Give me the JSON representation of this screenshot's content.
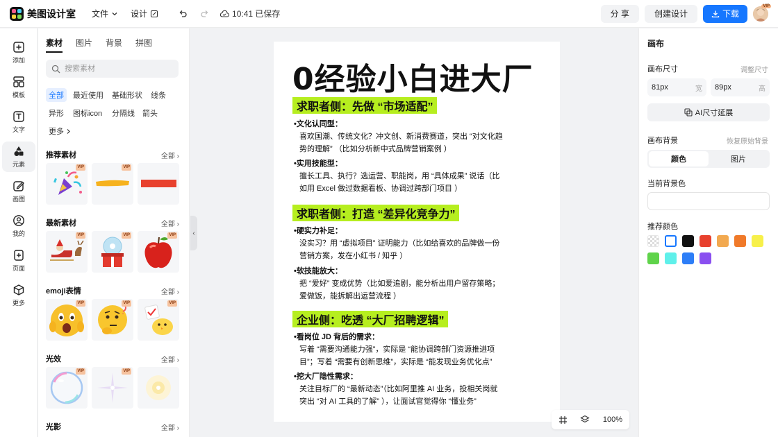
{
  "app": {
    "name": "美图设计室"
  },
  "topbar": {
    "file_menu": "文件",
    "design_menu": "设计",
    "saved_status": "10:41 已保存",
    "share_label": "分 享",
    "create_label": "创建设计",
    "download_label": "下载",
    "avatar_badge": "VIP"
  },
  "rail": {
    "items": [
      {
        "label": "添加",
        "icon": "plus-icon"
      },
      {
        "label": "模板",
        "icon": "template-icon"
      },
      {
        "label": "文字",
        "icon": "text-icon"
      },
      {
        "label": "元素",
        "icon": "shapes-icon"
      },
      {
        "label": "画图",
        "icon": "pen-icon"
      },
      {
        "label": "我的",
        "icon": "user-icon"
      },
      {
        "label": "页面",
        "icon": "page-add-icon"
      },
      {
        "label": "更多",
        "icon": "cube-icon"
      }
    ],
    "active_index": 3
  },
  "panel": {
    "tabs": [
      "素材",
      "图片",
      "背景",
      "拼图"
    ],
    "search_placeholder": "搜索素材",
    "chips": [
      "全部",
      "最近使用",
      "基础形状",
      "线条",
      "异形",
      "图标icon",
      "分隔线",
      "箭头",
      "更多"
    ],
    "sections": [
      {
        "title": "推荐素材",
        "all": "全部"
      },
      {
        "title": "最新素材",
        "all": "全部"
      },
      {
        "title": "emoji表情",
        "all": "全部"
      },
      {
        "title": "光效",
        "all": "全部"
      },
      {
        "title": "光影",
        "all": "全部"
      }
    ],
    "vip_label": "VIP"
  },
  "document": {
    "title": "0经验小白进大厂",
    "sections": [
      {
        "heading": "求职者侧：先做 “市场适配”",
        "lines": [
          {
            "text": "•文化认同型：",
            "bold": true
          },
          {
            "text": "喜欢国潮、传统文化？冲文创、新消费赛道，突出 “对文化趋",
            "bold": false
          },
          {
            "text": "势的理解” （比如分析新中式品牌营销案例 ）",
            "bold": false
          },
          {
            "text": "•实用技能型：",
            "bold": true
          },
          {
            "text": "擅长工具、执行？选运营、职能岗，用 “具体成果” 说话（比",
            "bold": false
          },
          {
            "text": "如用 Excel 做过数据看板、协调过跨部门项目 ）",
            "bold": false
          }
        ]
      },
      {
        "heading": "求职者侧：打造 “差异化竞争力”",
        "lines": [
          {
            "text": "•硬实力补足：",
            "bold": true
          },
          {
            "text": "没实习？用 “虚拟项目” 证明能力（比如给喜欢的品牌做一份",
            "bold": false
          },
          {
            "text": "营销方案，发在小红书 / 知乎 ）",
            "bold": false
          },
          {
            "text": "•软技能放大：",
            "bold": true
          },
          {
            "text": "把 “爱好” 变成优势（比如爱追剧，能分析出用户留存策略；",
            "bold": false
          },
          {
            "text": "爱做饭，能拆解出运营流程 ）",
            "bold": false
          }
        ]
      },
      {
        "heading": "企业侧：吃透 “大厂招聘逻辑”",
        "lines": [
          {
            "text": "•看岗位 JD 背后的需求：",
            "bold": true
          },
          {
            "text": "写着 “需要沟通能力强”，实际是 “能协调跨部门资源推进项",
            "bold": false
          },
          {
            "text": "目”；写着 “需要有创新思维”，实际是 “能发现业务优化点”",
            "bold": false
          },
          {
            "text": "•挖大厂隐性需求：",
            "bold": true
          },
          {
            "text": "关注目标厂的 “最新动态”（比如阿里推 AI 业务，投相关岗就",
            "bold": false
          },
          {
            "text": "突出 “对 AI 工具的了解” ），让面试官觉得你 “懂业务”",
            "bold": false
          }
        ]
      }
    ]
  },
  "zoom": {
    "level": "100%"
  },
  "right_panel": {
    "title": "画布",
    "size_label": "画布尺寸",
    "adjust_link": "调整尺寸",
    "width_value": "81px",
    "width_unit": "宽",
    "height_value": "89px",
    "height_unit": "高",
    "ai_extend_label": "AI尺寸延展",
    "bg_label": "画布背景",
    "restore_link": "恢复原始背景",
    "seg_color": "颜色",
    "seg_image": "图片",
    "current_bg_label": "当前背景色",
    "current_bg_color": "#ffffff",
    "recommended_label": "推荐颜色",
    "swatches": [
      "transparent",
      "#ffffff",
      "#111111",
      "#e8412e",
      "#f2a950",
      "#f07a2a",
      "#f7f04a",
      "#5fd34a",
      "#5ff0ea",
      "#2d7ef7",
      "#8a4ff0"
    ]
  },
  "colors": {
    "accent": "#1677ff",
    "highlight": "#b6ee1f"
  }
}
